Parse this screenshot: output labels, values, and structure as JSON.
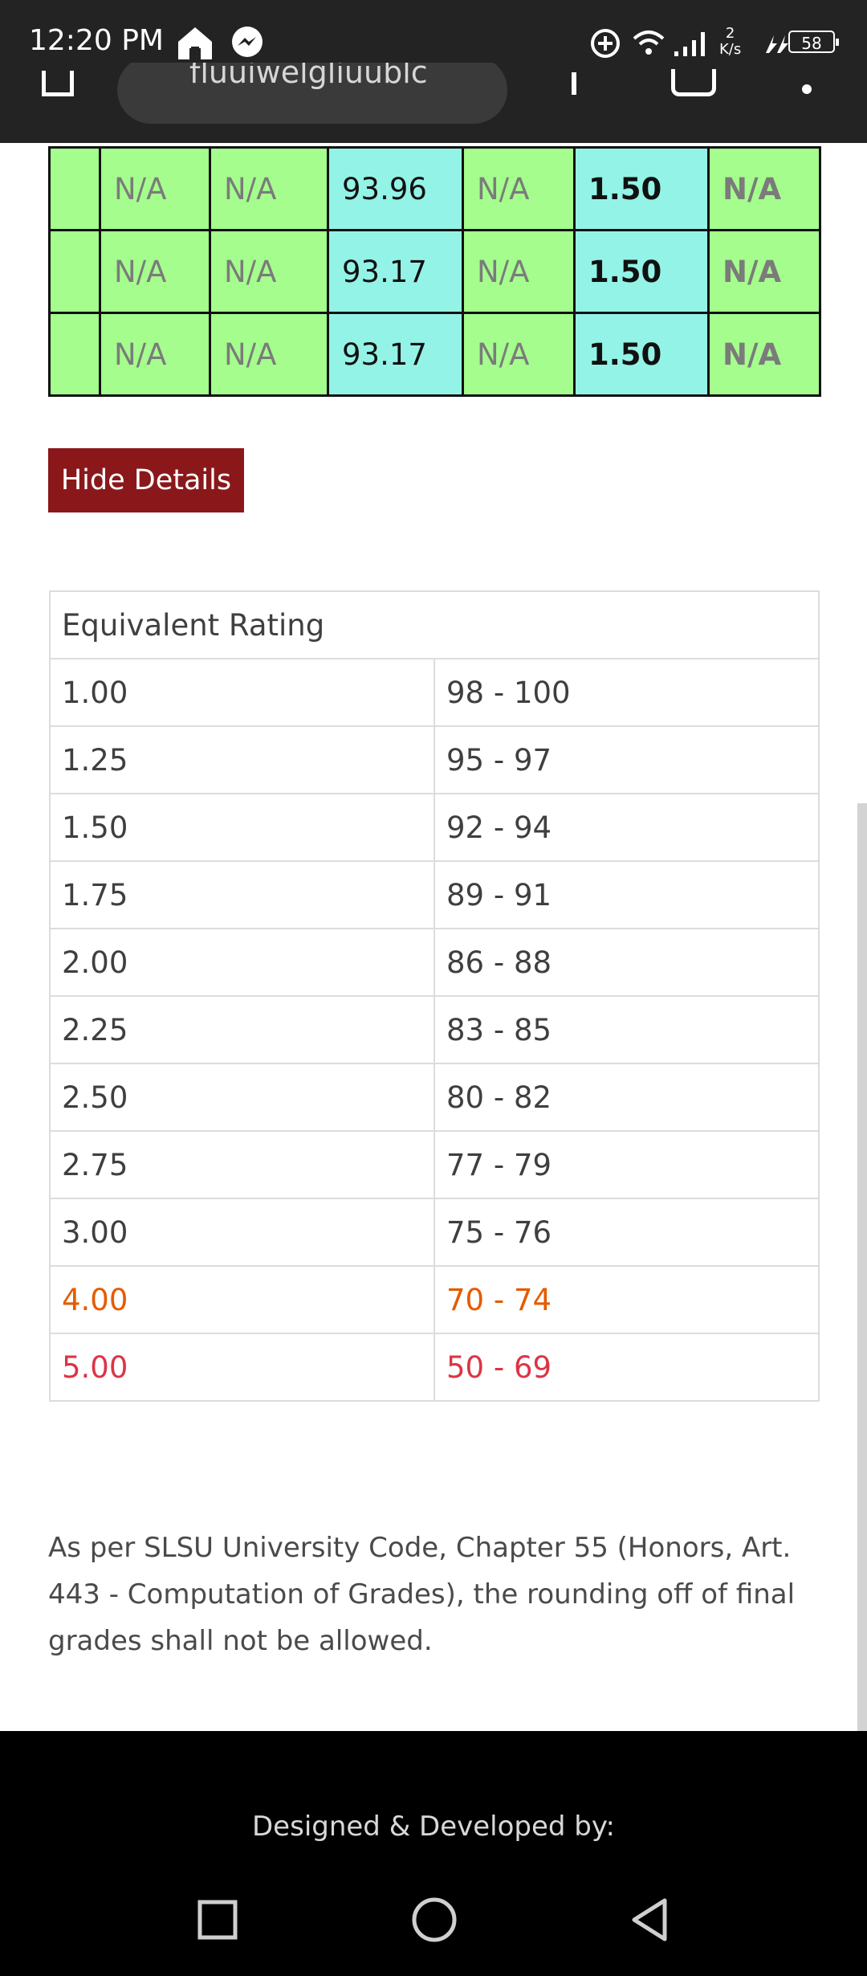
{
  "status_bar": {
    "time": "12:20 PM",
    "net_speed_value": "2",
    "net_speed_unit": "K/s",
    "battery": "58"
  },
  "browser": {
    "url_fragment": "fluuiwelgliuublc"
  },
  "grades_rows": [
    {
      "c1": "N/A",
      "c2": "N/A",
      "c3": "93.96",
      "c4": "N/A",
      "c5": "1.50",
      "c6": "N/A"
    },
    {
      "c1": "N/A",
      "c2": "N/A",
      "c3": "93.17",
      "c4": "N/A",
      "c5": "1.50",
      "c6": "N/A"
    },
    {
      "c1": "N/A",
      "c2": "N/A",
      "c3": "93.17",
      "c4": "N/A",
      "c5": "1.50",
      "c6": "N/A"
    }
  ],
  "hide_details_label": "Hide Details",
  "equivalent": {
    "header": "Equivalent Rating",
    "rows": [
      {
        "rating": "1.00",
        "range": "98 - 100"
      },
      {
        "rating": "1.25",
        "range": "95 - 97"
      },
      {
        "rating": "1.50",
        "range": "92 - 94"
      },
      {
        "rating": "1.75",
        "range": "89 - 91"
      },
      {
        "rating": "2.00",
        "range": "86 - 88"
      },
      {
        "rating": "2.25",
        "range": "83 - 85"
      },
      {
        "rating": "2.50",
        "range": "80 - 82"
      },
      {
        "rating": "2.75",
        "range": "77 - 79"
      },
      {
        "rating": "3.00",
        "range": "75 - 76"
      },
      {
        "rating": "4.00",
        "range": "70 - 74"
      },
      {
        "rating": "5.00",
        "range": "50 - 69"
      }
    ]
  },
  "note": "As per SLSU University Code, Chapter 55 (Honors, Art. 443 - Computation of Grades), the rounding off of final grades shall not be allowed.",
  "footer_text": "Designed & Developed by:",
  "colors": {
    "green_cell": "#a4fd8c",
    "cyan_cell": "#93f3e6",
    "button": "#8a181b",
    "orange": "#e55b00",
    "red": "#dc3545"
  }
}
